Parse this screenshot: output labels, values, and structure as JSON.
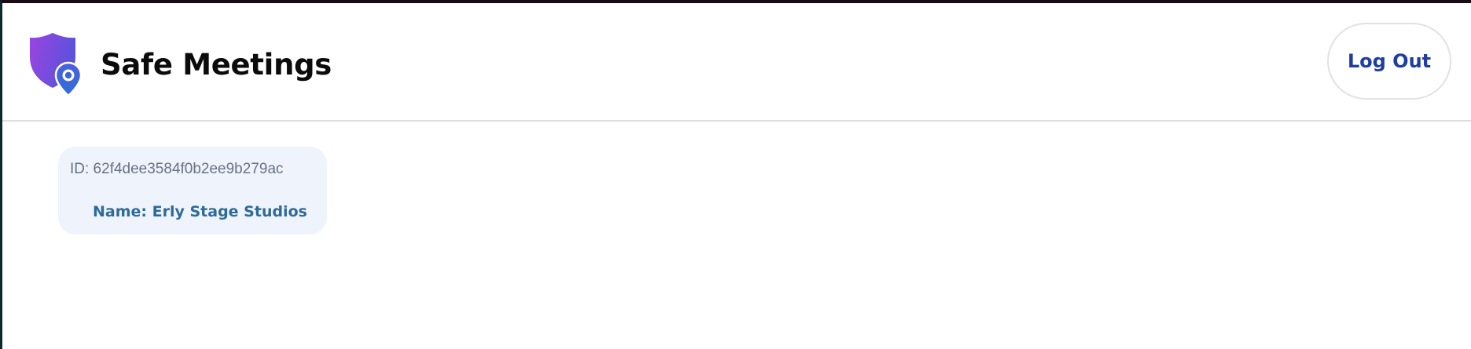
{
  "header": {
    "app_title": "Safe Meetings",
    "logo_icon": "shield-location-pin-icon",
    "logout_label": "Log Out"
  },
  "meeting_card": {
    "id_text": "ID: 62f4dee3584f0b2ee9b279ac",
    "name_text": "Name: Erly Stage Studios"
  },
  "colors": {
    "accent": "#1e3fa0",
    "card_background": "#eef3fc",
    "card_name": "#2e6a97",
    "logo_gradient_start": "#9b44e0",
    "logo_gradient_end": "#3a6fd8"
  }
}
